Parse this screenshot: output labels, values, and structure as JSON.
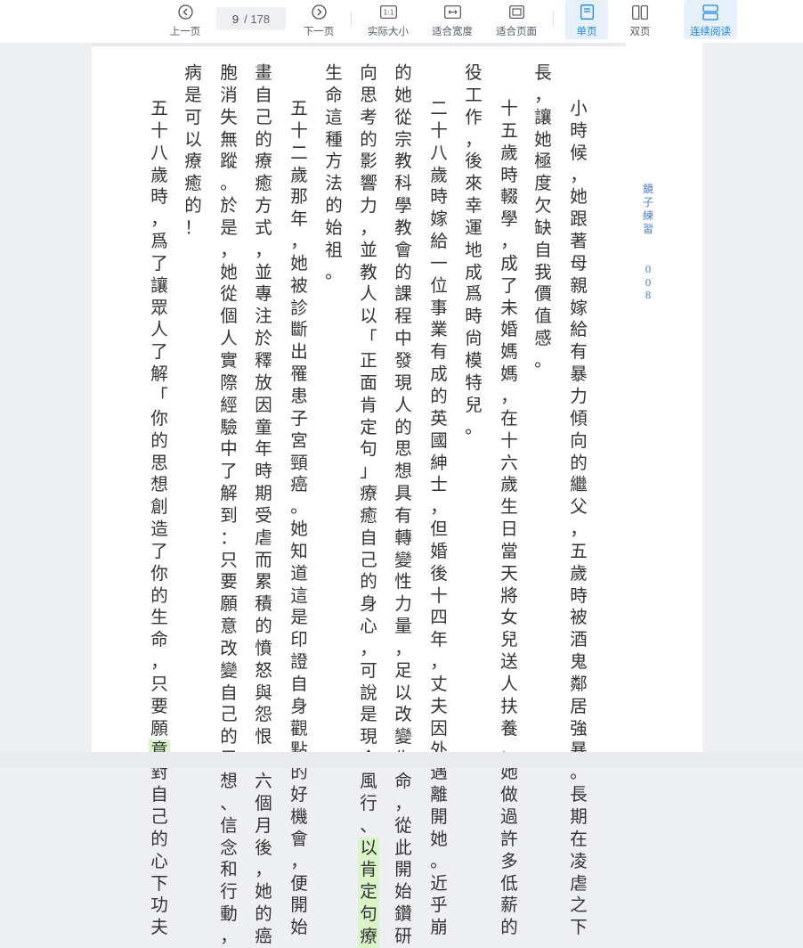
{
  "toolbar": {
    "prev_label": "上一页",
    "next_label": "下一页",
    "current_page": "9",
    "total_pages": "/ 178",
    "actual_size_label": "实际大小",
    "fit_width_label": "适合宽度",
    "fit_page_label": "适合页面",
    "single_page_label": "单页",
    "double_page_label": "双页",
    "continuous_label": "连续阅读",
    "actual_size_glyph": "1:1",
    "accent_color": "#1e88e5"
  },
  "sidebar": {
    "title": "鏡子練習",
    "page_no": "008"
  },
  "columns": [
    "小時候，她跟著母親嫁給有暴力傾向的繼父，五歲時被酒鬼鄰居強暴。長期在凌虐之下",
    "長，讓她極度欠缺自我價值感。",
    "十五歲時輟學，成了未婚媽媽，在十六歲生日當天將女兒送人扶養。她做過許多低薪的",
    "役工作，後來幸運地成爲時尙模特兒。",
    "二十八歲時嫁給一位事業有成的英國紳士，但婚後十四年，丈夫因外遇離開她。近乎崩",
    "的她從宗教科學教會的課程中發現人的思想具有轉變性力量，足以改變生命，從此開始鑽研",
    "向思考的影響力，並教人以「正面肯定句」療癒自己的身心，可說是現今風行、以肯定句療",
    "生命這種方法的始祖。",
    "五十二歲那年，她被診斷出罹患子宮頸癌。她知道這是印證自身觀點的好機會，便開始",
    "畫自己的療癒方式，並專注於釋放因童年時期受虐而累積的憤怒與怨恨。六個月後，她的癌",
    "胞消失無蹤。於是，她從個人實際經驗中了解到：只要願意改變自己的思想、信念和行動，",
    "病是可以療癒的！",
    "五十八歲時，爲了讓眾人了解「你的思想創造了你的生命，只要願意對自己的心下功夫"
  ]
}
